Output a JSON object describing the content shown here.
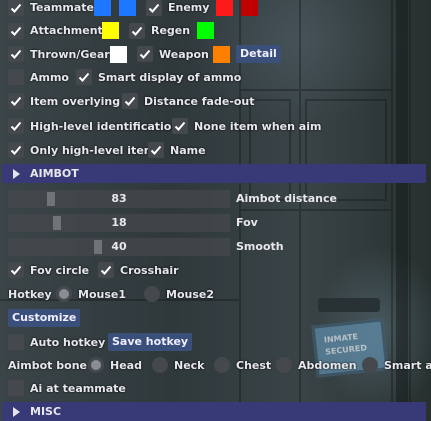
{
  "visuals": {
    "check_color": "#ffffff",
    "checkbox_bg": "#45494e",
    "header_bg": "#383a78",
    "button_bg": "#3b4f7b",
    "sign_text": [
      "INMATE",
      "SECURED"
    ]
  },
  "visibility": {
    "teammate": {
      "label": "Teammate",
      "checked": true,
      "colors": [
        "#1e78ff",
        "#1e78ff"
      ]
    },
    "enemy": {
      "label": "Enemy",
      "checked": true,
      "colors": [
        "#ff1a1a",
        "#c00000"
      ]
    },
    "attachment": {
      "label": "Attachment",
      "checked": true,
      "color": "#ffff00"
    },
    "regen": {
      "label": "Regen",
      "checked": true,
      "color": "#00ff00"
    },
    "thrown_gear": {
      "label": "Thrown/Gear",
      "checked": true,
      "color": "#ffffff"
    },
    "weapon": {
      "label": "Weapon",
      "checked": true,
      "color": "#ff8000"
    },
    "detail_button": "Detail",
    "ammo": {
      "label": "Ammo",
      "checked": false
    },
    "smart_ammo": {
      "label": "Smart display of ammo",
      "checked": true
    },
    "item_overlying": {
      "label": "Item overlying",
      "checked": true
    },
    "distance_fade": {
      "label": "Distance fade-out",
      "checked": true
    },
    "high_level_id": {
      "label": "High-level identification",
      "checked": true
    },
    "none_item_aim": {
      "label": "None item when aim",
      "checked": true
    },
    "only_high_level": {
      "label": "Only high-level item",
      "checked": true
    },
    "name": {
      "label": "Name",
      "checked": true
    }
  },
  "aimbot": {
    "header": "AIMBOT",
    "sliders": [
      {
        "label": "Aimbot distance",
        "value": "83",
        "fraction": 0.18
      },
      {
        "label": "Fov",
        "value": "18",
        "fraction": 0.21
      },
      {
        "label": "Smooth",
        "value": "40",
        "fraction": 0.4
      }
    ],
    "fov_circle": {
      "label": "Fov circle",
      "checked": true
    },
    "crosshair": {
      "label": "Crosshair",
      "checked": true
    },
    "hotkey_label": "Hotkey",
    "hotkey_options": [
      {
        "label": "Mouse1",
        "selected": true
      },
      {
        "label": "Mouse2",
        "selected": false
      }
    ],
    "customize_button": "Customize",
    "auto_hotkey": {
      "label": "Auto hotkey",
      "checked": false
    },
    "save_hotkey_button": "Save hotkey",
    "bone_label": "Aimbot bone",
    "bones": [
      {
        "label": "Head",
        "selected": true
      },
      {
        "label": "Neck",
        "selected": false
      },
      {
        "label": "Chest",
        "selected": false
      },
      {
        "label": "Abdomen",
        "selected": false
      },
      {
        "label": "Smart aim",
        "selected": false
      }
    ],
    "ai_teammate": {
      "label": "Ai at teammate",
      "checked": false
    }
  },
  "misc": {
    "header": "MISC"
  }
}
